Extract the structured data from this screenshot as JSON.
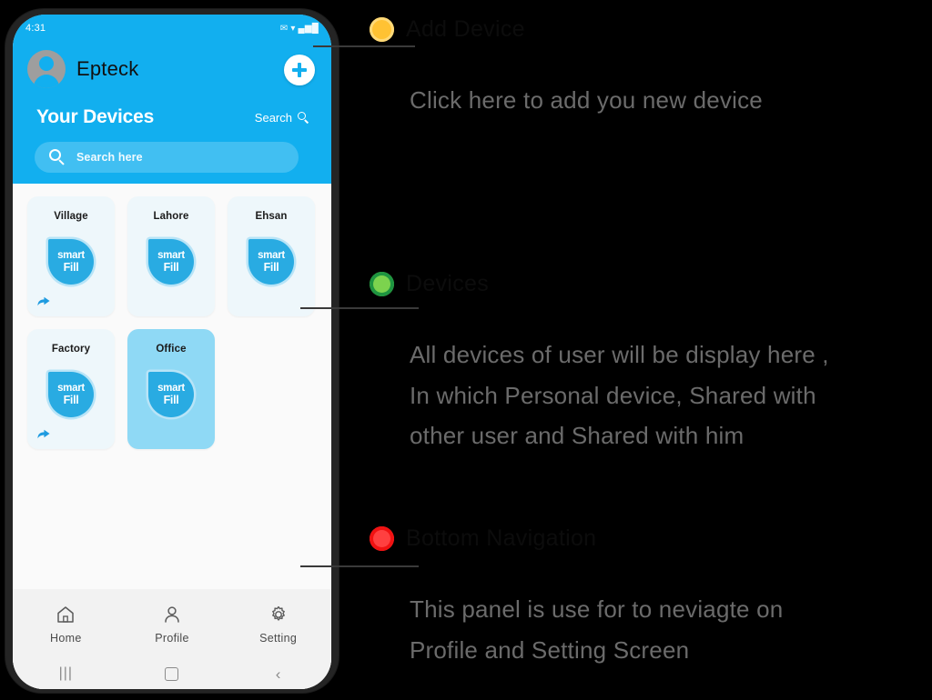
{
  "phone": {
    "statusbar": {
      "time": "4:31",
      "icons": "✉ ▾ ▄▆█"
    },
    "header": {
      "brand": "Epteck",
      "avatar_icon": "person-avatar-icon",
      "add_button_icon": "plus-icon",
      "section_title": "Your Devices",
      "search_link": "Search",
      "search_link_icon": "search-icon",
      "search_input_placeholder": "Search here",
      "search_input_value": "",
      "search_input_icon": "search-icon",
      "accent_color": "#12AFEF"
    },
    "devices": [
      {
        "name": "Village",
        "logo_line1": "smart",
        "logo_line2": "Fill",
        "shared": true,
        "selected": false
      },
      {
        "name": "Lahore",
        "logo_line1": "smart",
        "logo_line2": "Fill",
        "shared": false,
        "selected": false
      },
      {
        "name": "Ehsan",
        "logo_line1": "smart",
        "logo_line2": "Fill",
        "shared": false,
        "selected": false
      },
      {
        "name": "Factory",
        "logo_line1": "smart",
        "logo_line2": "Fill",
        "shared": true,
        "selected": false
      },
      {
        "name": "Office",
        "logo_line1": "smart",
        "logo_line2": "Fill",
        "shared": false,
        "selected": true
      }
    ],
    "bottom_nav": [
      {
        "label": "Home",
        "icon": "home-icon"
      },
      {
        "label": "Profile",
        "icon": "person-icon"
      },
      {
        "label": "Setting",
        "icon": "gear-icon"
      }
    ],
    "android_nav": [
      {
        "label": "|||",
        "icon": "recents-icon"
      },
      {
        "label": "",
        "icon": "home-square-icon"
      },
      {
        "label": "‹",
        "icon": "back-icon"
      }
    ]
  },
  "annotations": [
    {
      "marker_color": "#FFC233",
      "heading": "Add Device",
      "body": "Click here to add you new device"
    },
    {
      "marker_color": "#7CD34E",
      "heading": "Devices",
      "body": "All devices of user will be display here ,\nIn which Personal device, Shared with\nother user and Shared with him"
    },
    {
      "marker_color": "#FF4040",
      "heading": "Bottom Navigation",
      "body": "This panel is use for to neviagte on\nProfile and Setting Screen"
    }
  ]
}
